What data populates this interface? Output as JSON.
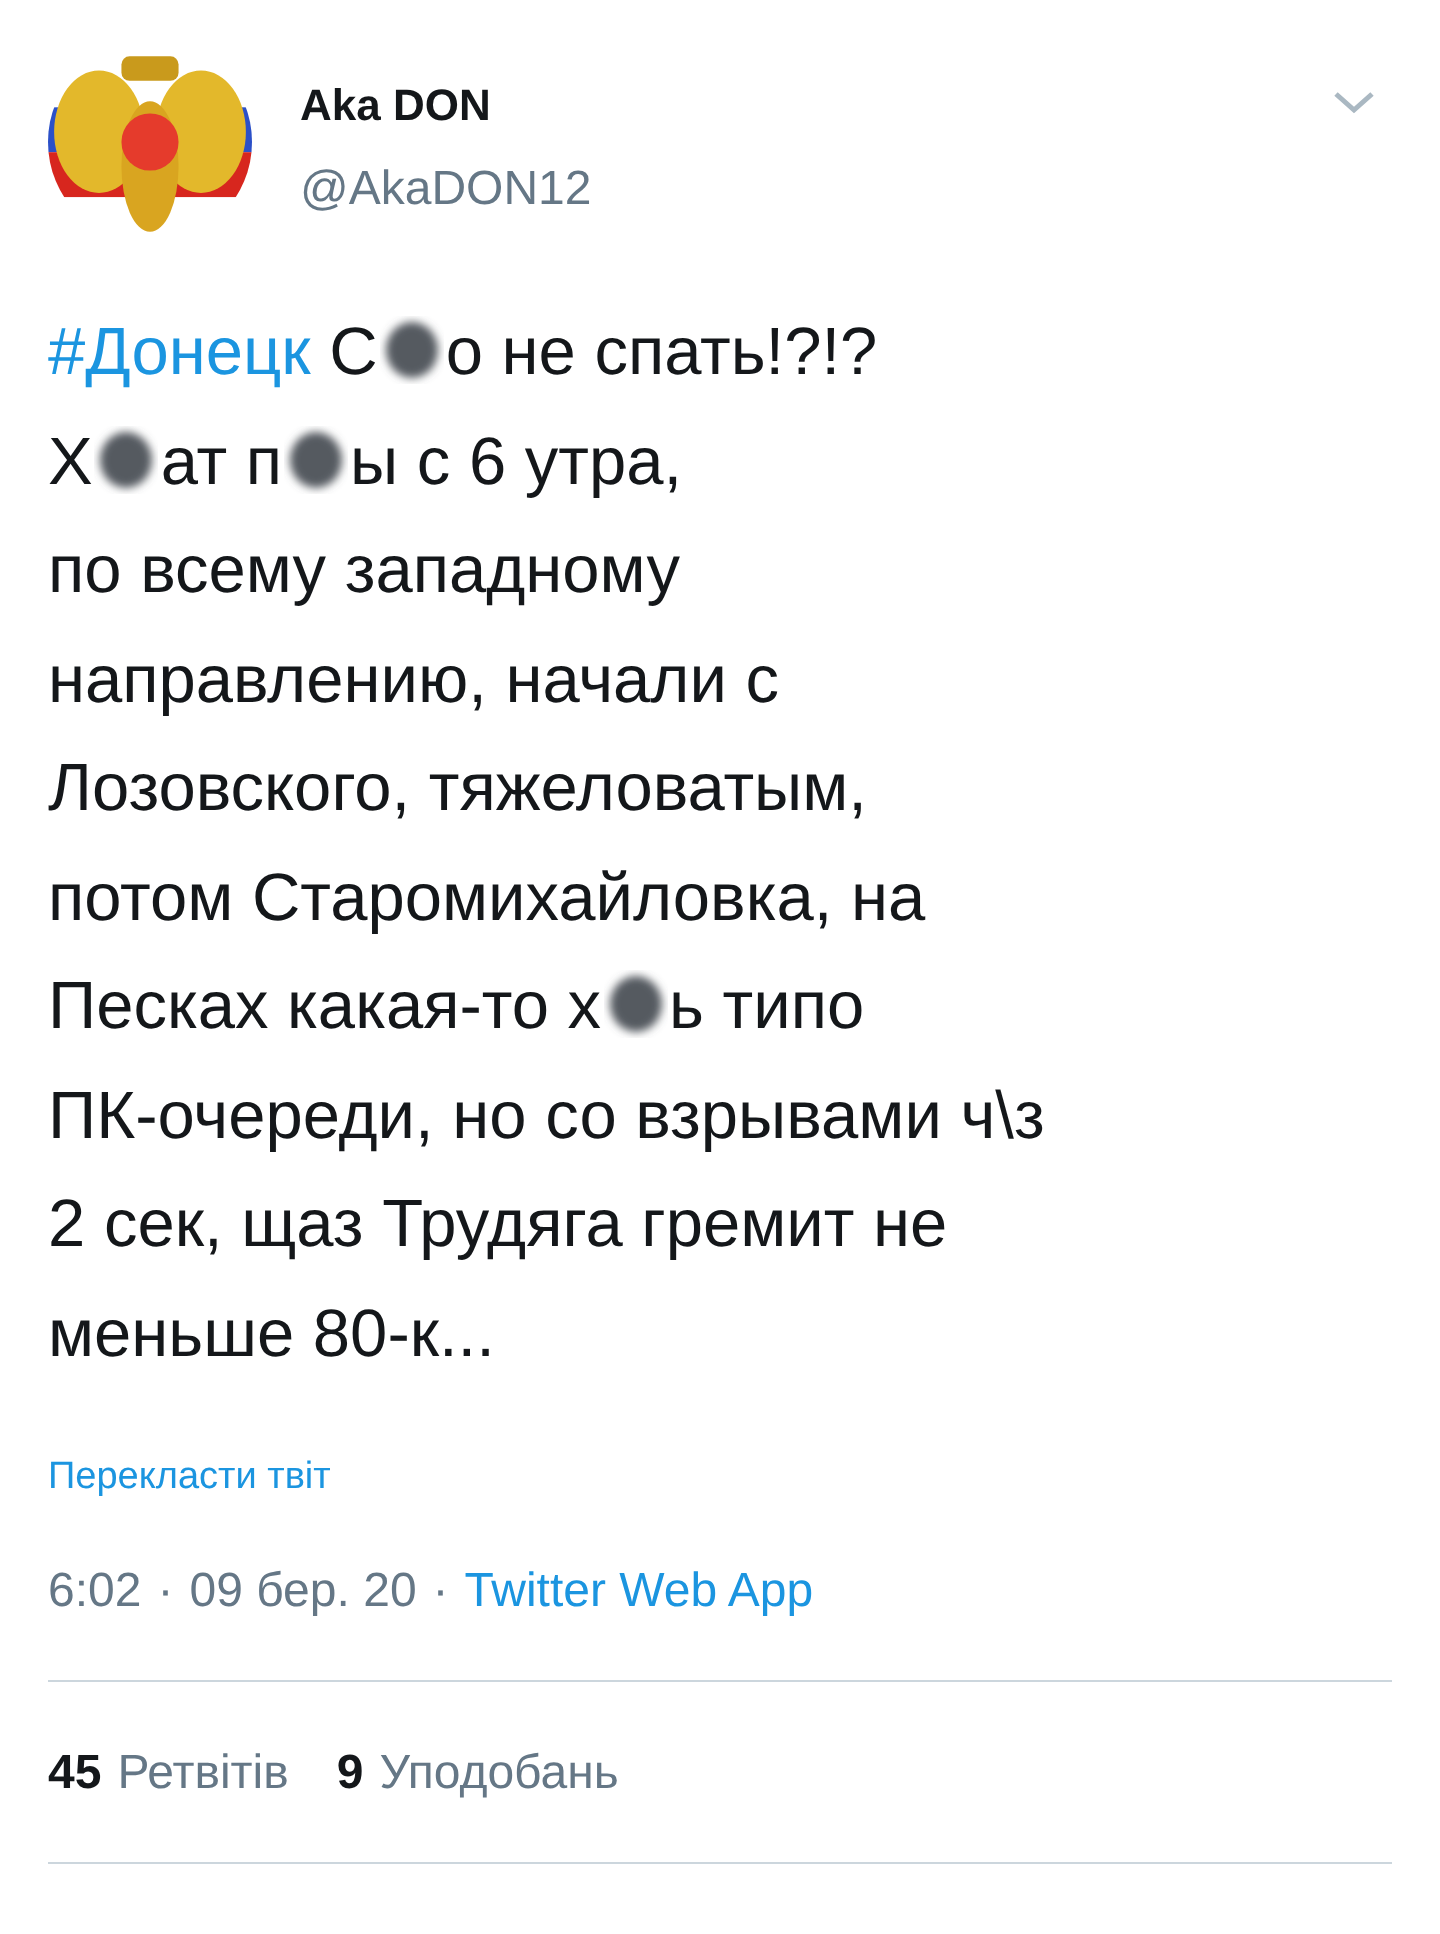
{
  "author": {
    "name": "Aka DON",
    "handle": "@AkaDON12"
  },
  "body": [
    [
      {
        "kind": "hashtag",
        "text": "#Донецк"
      },
      {
        "kind": "text",
        "text": " С"
      },
      {
        "kind": "redacted"
      },
      {
        "kind": "text",
        "text": "о не спать!?!?"
      }
    ],
    [
      {
        "kind": "text",
        "text": "Х"
      },
      {
        "kind": "redacted"
      },
      {
        "kind": "text",
        "text": "ат п"
      },
      {
        "kind": "redacted"
      },
      {
        "kind": "text",
        "text": "ы с 6 утра,"
      }
    ],
    [
      {
        "kind": "text",
        "text": "по всему западному"
      }
    ],
    [
      {
        "kind": "text",
        "text": "направлению, начали с"
      }
    ],
    [
      {
        "kind": "text",
        "text": "Лозовского, тяжеловатым,"
      }
    ],
    [
      {
        "kind": "text",
        "text": "потом Старомихайловка, на"
      }
    ],
    [
      {
        "kind": "text",
        "text": "Песках какая-то х"
      },
      {
        "kind": "redacted"
      },
      {
        "kind": "text",
        "text": "ь типо"
      }
    ],
    [
      {
        "kind": "text",
        "text": "ПК-очереди, но со взрывами ч\\з"
      }
    ],
    [
      {
        "kind": "text",
        "text": "2 сек, щаз Трудяга гремит не"
      }
    ],
    [
      {
        "kind": "text",
        "text": "меньше 80-к..."
      }
    ]
  ],
  "translate_link": "Перекласти твіт",
  "meta": {
    "time": "6:02",
    "separator_1": "·",
    "date": "09 бер. 20",
    "separator_2": "·",
    "source": "Twitter Web App"
  },
  "stats": [
    {
      "count": "45",
      "label": "Ретвітів"
    },
    {
      "count": "9",
      "label": "Уподобань"
    }
  ]
}
